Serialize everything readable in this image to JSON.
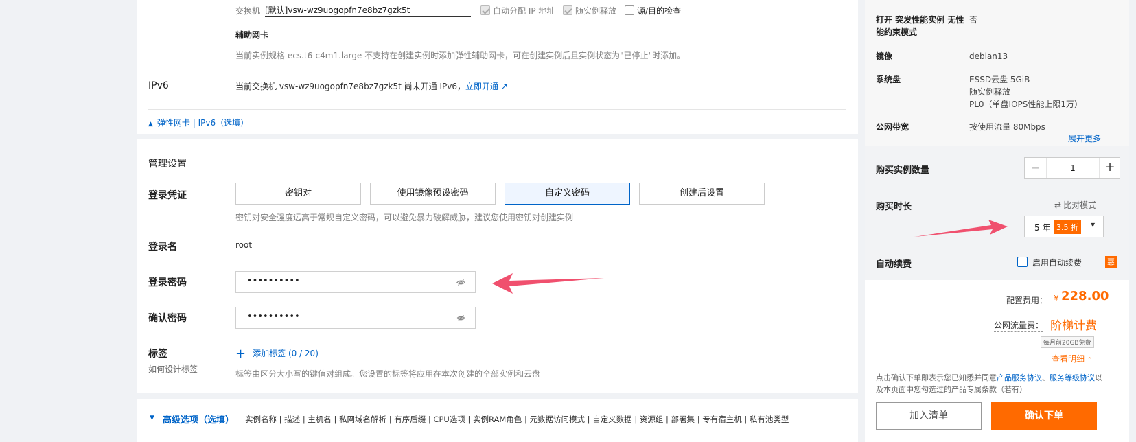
{
  "network": {
    "switch_label": "交换机",
    "switch_value": "[默认]vsw-wz9uogopfn7e8bz7gzk5t",
    "auto_ip_label": "自动分配 IP 地址",
    "release_with_instance_label": "随实例释放",
    "src_dst_check_label": "源/目的检查",
    "secondary_nic_title": "辅助网卡",
    "secondary_nic_note": "当前实例规格 ecs.t6-c4m1.large 不支持在创建实例时添加弹性辅助网卡，可在创建实例后且实例状态为\"已停止\"时添加。",
    "ipv6_label": "IPv6",
    "ipv6_note": "当前交换机 vsw-wz9uogopfn7e8bz7gzk5t 尚未开通 IPv6，",
    "ipv6_link": "立即开通",
    "collapse_label": "弹性网卡 | IPv6（选填）"
  },
  "management": {
    "title": "管理设置",
    "credential_label": "登录凭证",
    "credential_options": [
      "密钥对",
      "使用镜像预设密码",
      "自定义密码",
      "创建后设置"
    ],
    "credential_selected": "自定义密码",
    "credential_note": "密钥对安全强度远高于常规自定义密码，可以避免暴力破解威胁，建议您使用密钥对创建实例",
    "login_name_label": "登录名",
    "login_name_value": "root",
    "password_label": "登录密码",
    "password_value": "••••••••••",
    "confirm_label": "确认密码",
    "confirm_value": "••••••••••",
    "tag_label": "标签",
    "tag_help_link": "如何设计标签",
    "add_tag": "添加标签",
    "tag_count": "(0 / 20)",
    "tag_note": "标签由区分大小写的键值对组成。您设置的标签将应用在本次创建的全部实例和云盘"
  },
  "advanced": {
    "title": "高级选项（选填）",
    "items": "实例名称 | 描述 | 主机名 | 私网域名解析 | 有序后缀 | CPU选项 | 实例RAM角色 | 元数据访问模式 | 自定义数据 | 资源组 | 部署集 | 专有宿主机 | 私有池类型"
  },
  "summary": {
    "burst_label": "打开 突发性能实例 无性能约束模式",
    "burst_value": "否",
    "image_label": "镜像",
    "image_value": "debian13",
    "disk_label": "系统盘",
    "disk_lines": [
      "ESSD云盘 5GiB",
      "随实例释放",
      "PL0（单盘IOPS性能上限1万）"
    ],
    "bandwidth_label": "公网带宽",
    "bandwidth_value": "按使用流量 80Mbps",
    "expand_more": "展开更多",
    "quantity_label": "购买实例数量",
    "quantity_value": "1",
    "duration_label": "购买时长",
    "compare_mode": "比对模式",
    "duration_value": "5 年",
    "discount_badge": "3.5 折",
    "auto_renew_label": "自动续费",
    "auto_renew_checkbox": "启用自动续费",
    "promo_badge": "惠",
    "config_fee_label": "配置费用：",
    "config_fee_currency": "¥",
    "config_fee_value": "228.00",
    "traffic_fee_label": "公网流量费：",
    "traffic_fee_value": "阶梯计费",
    "free_quota": "每月前20GB免费",
    "view_details": "查看明细",
    "agreement_prefix": "点击确认下单即表示您已知悉并同意",
    "agreement_link1": "产品服务协议",
    "agreement_sep": "、",
    "agreement_link2": "服务等级协议",
    "agreement_suffix": "以及本页面中您勾选过的产品专属条款（若有）",
    "add_to_list": "加入清单",
    "confirm_order": "确认下单"
  },
  "colors": {
    "accent_blue": "#0064c8",
    "orange": "#ff6a00",
    "arrow_red": "#f0506e"
  }
}
